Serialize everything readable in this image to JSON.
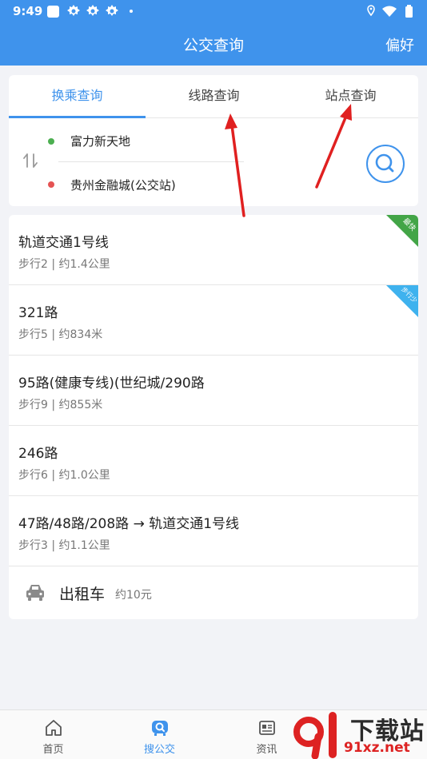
{
  "status": {
    "time": "9:49"
  },
  "header": {
    "title": "公交查询",
    "pref_label": "偏好"
  },
  "tabs": [
    {
      "label": "换乘查询",
      "active": true
    },
    {
      "label": "线路查询",
      "active": false
    },
    {
      "label": "站点查询",
      "active": false
    }
  ],
  "search": {
    "origin": "富力新天地",
    "destination": "贵州金融城(公交站)",
    "origin_color": "#4caf50",
    "destination_color": "#e55353"
  },
  "routes": [
    {
      "name": "轨道交通1号线",
      "meta": "步行2 | 约1.4公里",
      "badge": "最快",
      "badge_color": "#43a547"
    },
    {
      "name": "321路",
      "meta": "步行5 | 约834米",
      "badge": "步行少",
      "badge_color": "#3fb2ee"
    },
    {
      "name": "95路(健康专线)(世纪城/290路",
      "meta": "步行9 | 约855米"
    },
    {
      "name": "246路",
      "meta": "步行6 | 约1.0公里"
    },
    {
      "name": "47路/48路/208路 → 轨道交通1号线",
      "meta": "步行3 | 约1.1公里"
    }
  ],
  "taxi": {
    "label": "出租车",
    "price": "约10元"
  },
  "nav": [
    {
      "label": "首页",
      "icon": "home-icon"
    },
    {
      "label": "搜公交",
      "icon": "bus-search-icon",
      "active": true
    },
    {
      "label": "资讯",
      "icon": "news-icon"
    }
  ],
  "watermark": {
    "text": "下载站",
    "url": "91xz.net"
  },
  "colors": {
    "accent": "#3f93ec",
    "annotation": "#e02020"
  }
}
